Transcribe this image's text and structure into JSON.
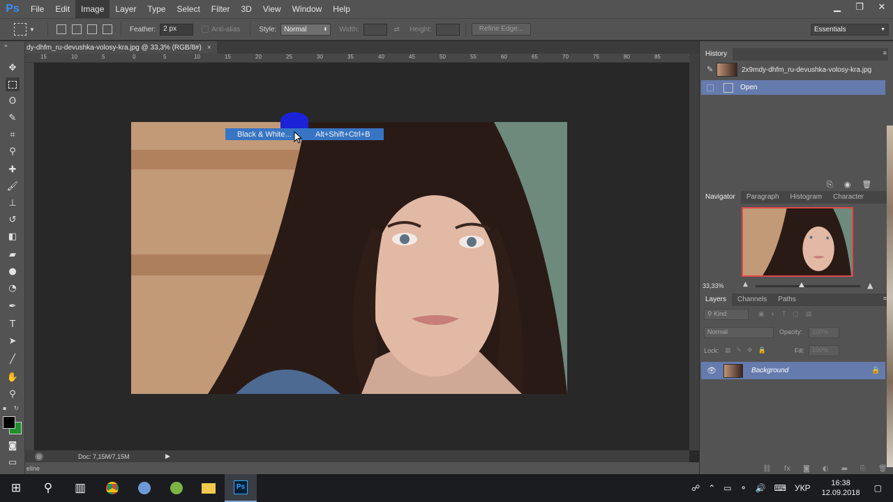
{
  "app": {
    "logo": "Ps"
  },
  "menu": [
    "File",
    "Edit",
    "Image",
    "Layer",
    "Type",
    "Select",
    "Filter",
    "3D",
    "View",
    "Window",
    "Help"
  ],
  "window_controls": {
    "minimize": "▁",
    "restore": "❐",
    "close": "✕"
  },
  "options": {
    "feather_label": "Feather:",
    "feather_value": "2 px",
    "antialias_label": "Anti-alias",
    "style_label": "Style:",
    "style_value": "Normal",
    "width_label": "Width:",
    "height_label": "Height:",
    "refine_edge": "Refine Edge...",
    "workspace": "Essentials"
  },
  "document": {
    "tab_title": "dy-dhfm_ru-devushka-volosy-kra.jpg @ 33,3% (RGB/8#)",
    "close_glyph": "×",
    "status_doc": "Doc: 7,15M/7,15M",
    "timeline_label": "eline"
  },
  "ruler_h_ticks": [
    "15",
    "10",
    "5",
    "0",
    "5",
    "10",
    "15",
    "20",
    "25",
    "30",
    "35",
    "40",
    "45",
    "50",
    "55",
    "60",
    "65",
    "70",
    "75",
    "80",
    "85"
  ],
  "menu_highlight": {
    "label": "Black & White...",
    "shortcut": "Alt+Shift+Ctrl+B"
  },
  "history": {
    "tab": "History",
    "snapshot_name": "2x9mdy-dhfm_ru-devushka-volosy-kra.jpg",
    "state_open": "Open"
  },
  "navigator": {
    "tabs": [
      "Navigator",
      "Paragraph",
      "Histogram",
      "Character"
    ],
    "zoom": "33,33%"
  },
  "layers": {
    "tabs": [
      "Layers",
      "Channels",
      "Paths"
    ],
    "filter_kind": "Kind",
    "blend_mode": "Normal",
    "opacity_label": "Opacity:",
    "opacity_value": "100%",
    "lock_label": "Lock:",
    "fill_label": "Fill:",
    "fill_value": "100%",
    "layer_name": "Background"
  },
  "taskbar": {
    "language": "УКР",
    "time": "16:38",
    "date": "12.09.2018"
  },
  "colors": {
    "accent": "#3775c4",
    "selection": "#667bad",
    "foreground_swatch": "#000000",
    "background_swatch": "#1f8f2a"
  }
}
